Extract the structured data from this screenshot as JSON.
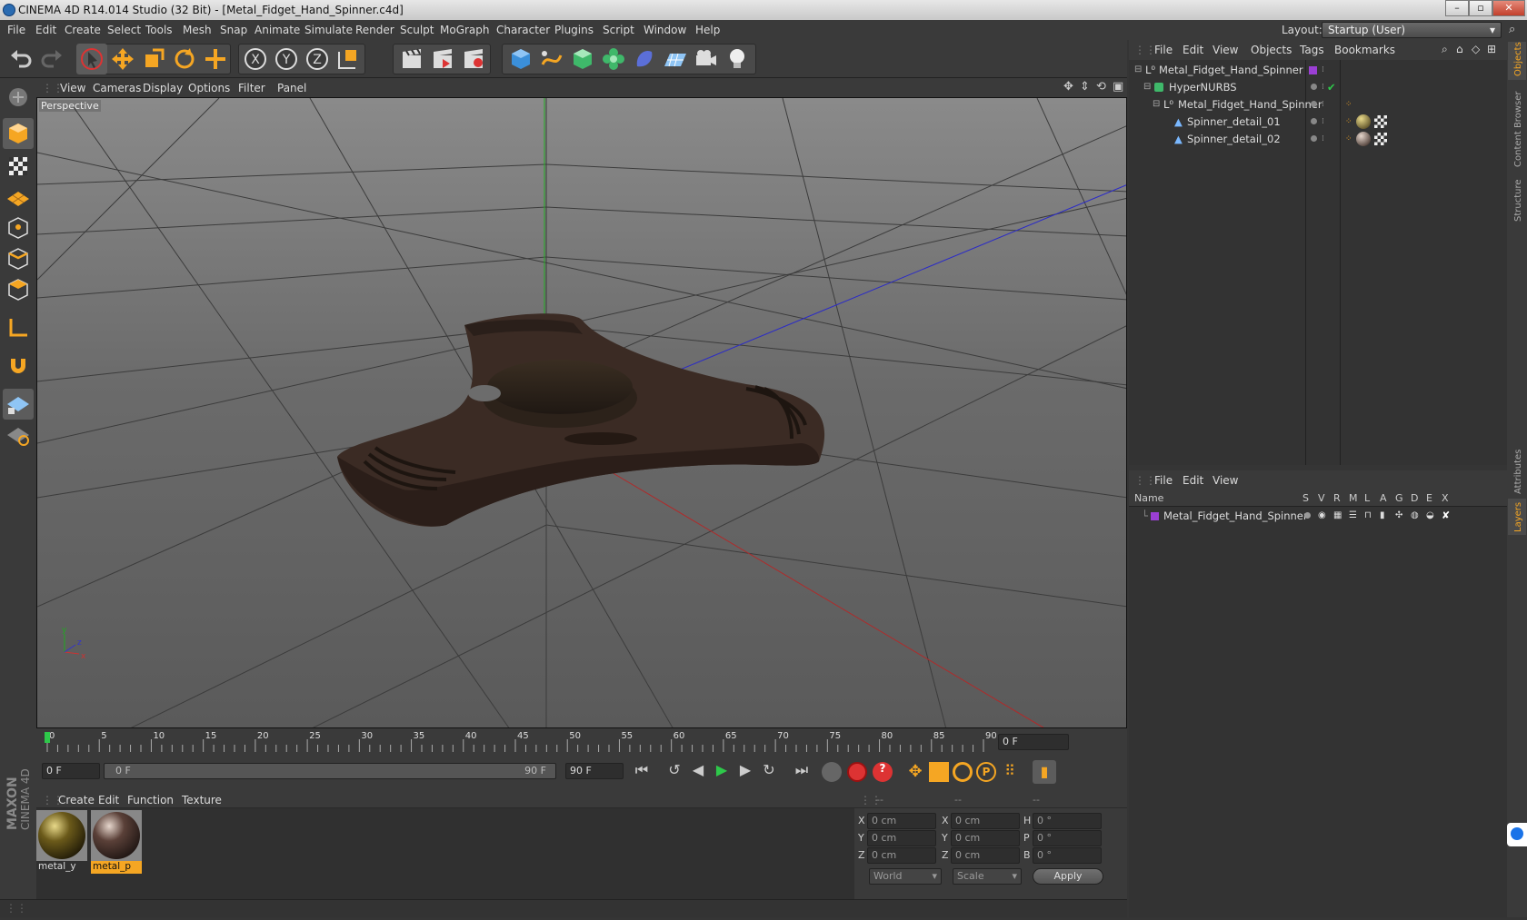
{
  "window": {
    "title": "CINEMA 4D R14.014 Studio (32 Bit) - [Metal_Fidget_Hand_Spinner.c4d]"
  },
  "menubar": {
    "items": [
      "File",
      "Edit",
      "Create",
      "Select",
      "Tools",
      "Mesh",
      "Snap",
      "Animate",
      "Simulate",
      "Render",
      "Sculpt",
      "MoGraph",
      "Character",
      "Plugins",
      "Script",
      "Window",
      "Help"
    ]
  },
  "layout": {
    "label": "Layout:",
    "value": "Startup (User)"
  },
  "viewport": {
    "menu": [
      "View",
      "Cameras",
      "Display",
      "Options",
      "Filter",
      "Panel"
    ],
    "label": "Perspective"
  },
  "timeline": {
    "ticks": [
      "0",
      "5",
      "10",
      "15",
      "20",
      "25",
      "30",
      "35",
      "40",
      "45",
      "50",
      "55",
      "60",
      "65",
      "70",
      "75",
      "80",
      "85",
      "90"
    ],
    "current_frame": "0 F"
  },
  "transport": {
    "start_field": "0 F",
    "range_start": "0 F",
    "range_end": "90 F",
    "end_field": "90 F"
  },
  "materials": {
    "menu": [
      "Create",
      "Edit",
      "Function",
      "Texture"
    ],
    "items": [
      {
        "name": "metal_y",
        "selected": false
      },
      {
        "name": "metal_p",
        "selected": true
      }
    ]
  },
  "coordinates": {
    "headers": [
      "--",
      "--",
      "--"
    ],
    "rows": [
      {
        "a": "X",
        "a_val": "0 cm",
        "b": "X",
        "b_val": "0 cm",
        "c": "H",
        "c_val": "0 °"
      },
      {
        "a": "Y",
        "a_val": "0 cm",
        "b": "Y",
        "b_val": "0 cm",
        "c": "P",
        "c_val": "0 °"
      },
      {
        "a": "Z",
        "a_val": "0 cm",
        "b": "Z",
        "b_val": "0 cm",
        "c": "B",
        "c_val": "0 °"
      }
    ],
    "space": "World",
    "mode": "Scale",
    "apply": "Apply"
  },
  "objects_panel": {
    "menu": [
      "File",
      "Edit",
      "View",
      "Objects",
      "Tags",
      "Bookmarks"
    ],
    "tree": [
      {
        "name": "Metal_Fidget_Hand_Spinner",
        "depth": 0
      },
      {
        "name": "HyperNURBS",
        "depth": 1
      },
      {
        "name": "Metal_Fidget_Hand_Spinner",
        "depth": 2
      },
      {
        "name": "Spinner_detail_01",
        "depth": 3
      },
      {
        "name": "Spinner_detail_02",
        "depth": 3
      }
    ]
  },
  "layers_panel": {
    "menu": [
      "File",
      "Edit",
      "View"
    ],
    "columns": [
      "Name",
      "S",
      "V",
      "R",
      "M",
      "L",
      "A",
      "G",
      "D",
      "E",
      "X"
    ],
    "rows": [
      {
        "name": "Metal_Fidget_Hand_Spinner"
      }
    ]
  },
  "right_tabs": [
    "Objects",
    "Content Browser",
    "Structure",
    "Attributes",
    "Layers"
  ],
  "brand": {
    "line1": "MAXON",
    "line2": "CINEMA 4D"
  },
  "colors": {
    "accent": "#f5a623",
    "layer": "#9b3fd4",
    "bg": "#3a3a3a"
  }
}
